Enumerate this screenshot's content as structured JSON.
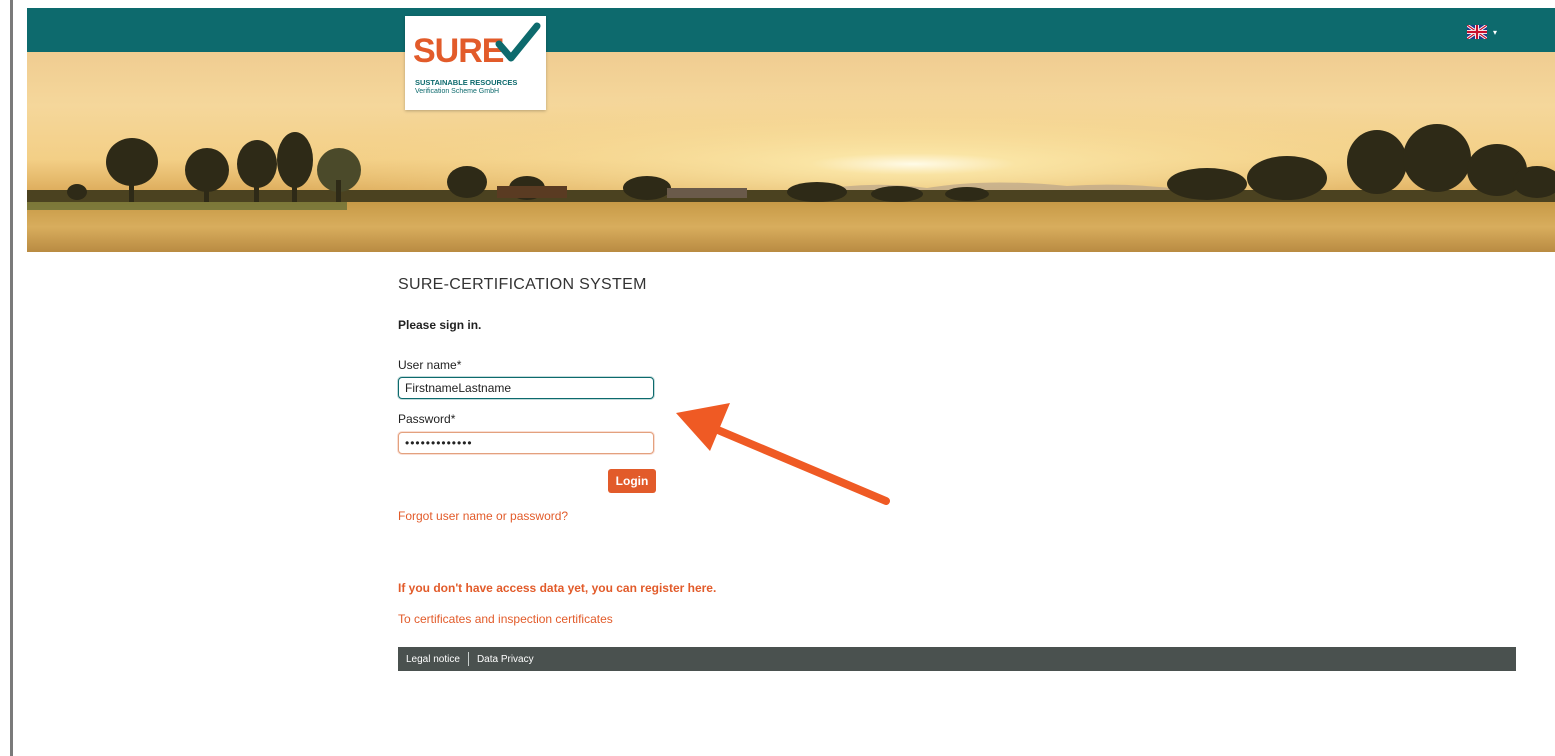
{
  "logo": {
    "word": "SURE",
    "line1": "SUSTAINABLE RESOURCES",
    "line2": "Verification Scheme GmbH"
  },
  "header": {
    "language_icon": "uk-flag-icon",
    "language_caret": "▾"
  },
  "main": {
    "title": "SURE-CERTIFICATION SYSTEM",
    "prompt": "Please sign in.",
    "username_label": "User name*",
    "username_value": "FirstnameLastname",
    "password_label": "Password*",
    "password_value": "•••••••••••••",
    "login_label": "Login",
    "forgot_link": "Forgot user name or password?",
    "register_link": "If you don't have access data yet, you can register here.",
    "certificates_link": "To certificates and inspection certificates"
  },
  "footer": {
    "legal_notice": "Legal notice",
    "data_privacy": "Data Privacy"
  },
  "colors": {
    "teal": "#0d6a6d",
    "accent": "#e25b2a",
    "footer": "#4a514f",
    "annotation_arrow": "#ef5a24"
  }
}
